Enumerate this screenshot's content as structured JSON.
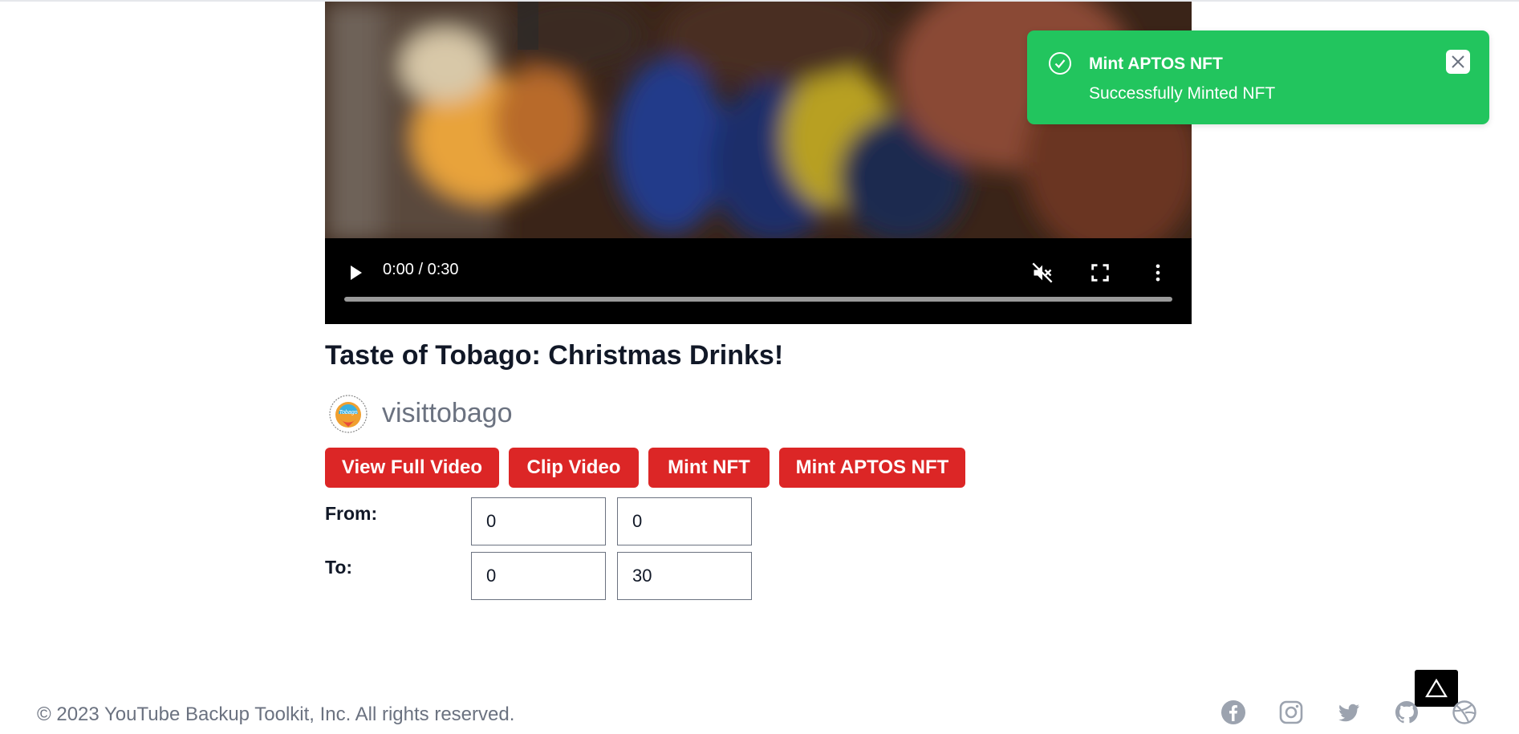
{
  "video": {
    "time_display": "0:00 / 0:30",
    "progress": 0,
    "muted": true,
    "controls": [
      "play-icon",
      "volume-muted-icon",
      "fullscreen-icon",
      "more-vertical-icon"
    ]
  },
  "title": "Taste of Tobago: Christmas Drinks!",
  "channel": {
    "name": "visittobago",
    "avatar_text": "Tobago"
  },
  "actions": {
    "view_full_video": "View Full Video",
    "clip_video": "Clip Video",
    "mint_nft": "Mint NFT",
    "mint_aptos_nft": "Mint APTOS NFT"
  },
  "range": {
    "from_label": "From:",
    "to_label": "To:",
    "from_minutes": "0",
    "from_seconds": "0",
    "to_minutes": "0",
    "to_seconds": "30"
  },
  "toast": {
    "title": "Mint APTOS NFT",
    "message": "Successfully Minted NFT",
    "color": "#22c55e"
  },
  "footer": {
    "copyright": "© 2023 YouTube Backup Toolkit, Inc. All rights reserved.",
    "social": [
      "facebook-icon",
      "instagram-icon",
      "twitter-icon",
      "github-icon",
      "dribbble-icon"
    ]
  },
  "colors": {
    "button": "#dc2626",
    "muted_text": "#6b7280",
    "footer_icons": "#9ca3af"
  }
}
